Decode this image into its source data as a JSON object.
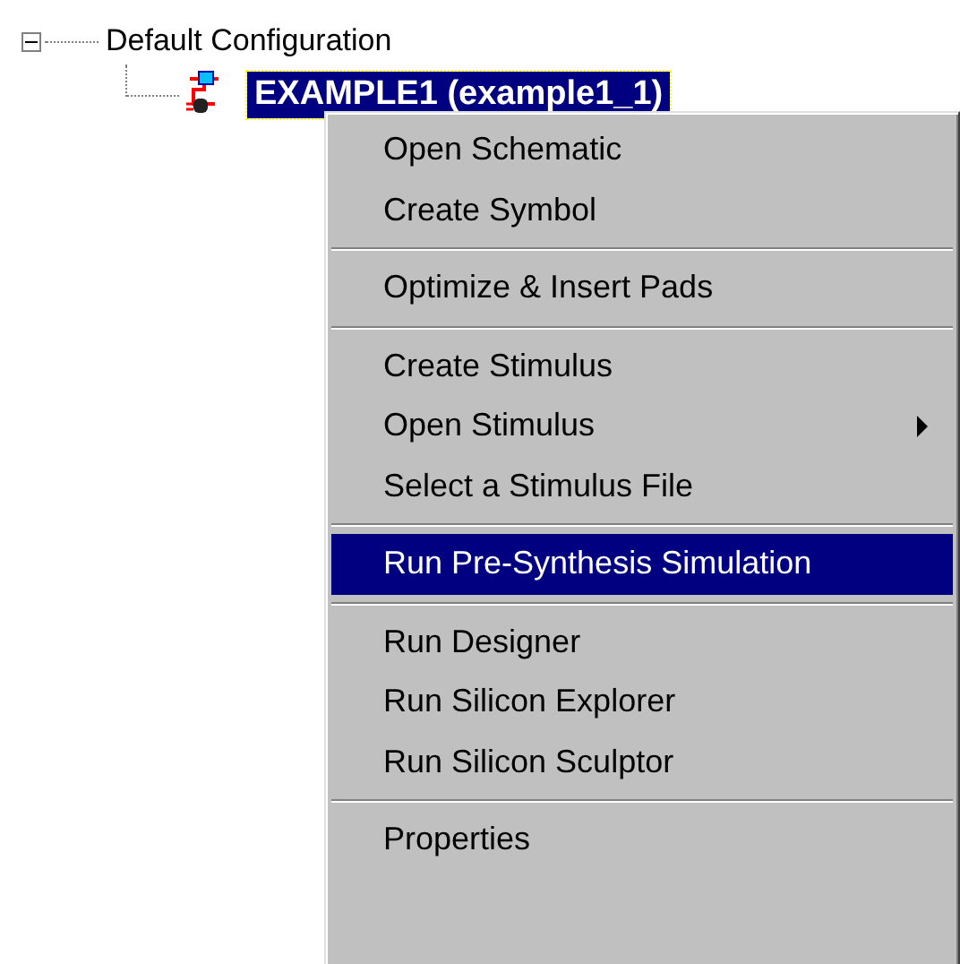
{
  "tree": {
    "label": "Default Configuration",
    "expanded": true,
    "children": [
      {
        "label": "EXAMPLE1 (example1_1)",
        "selected": true
      }
    ]
  },
  "context_menu": {
    "items": [
      {
        "kind": "item",
        "label": "Open Schematic",
        "selected": false,
        "submenu": false
      },
      {
        "kind": "item",
        "label": "Create Symbol",
        "selected": false,
        "submenu": false
      },
      {
        "kind": "separator"
      },
      {
        "kind": "item",
        "label": "Optimize & Insert Pads",
        "selected": false,
        "submenu": false
      },
      {
        "kind": "separator"
      },
      {
        "kind": "item",
        "label": "Create Stimulus",
        "selected": false,
        "submenu": false
      },
      {
        "kind": "item",
        "label": "Open Stimulus",
        "selected": false,
        "submenu": true
      },
      {
        "kind": "item",
        "label": "Select a Stimulus File",
        "selected": false,
        "submenu": false
      },
      {
        "kind": "separator"
      },
      {
        "kind": "item",
        "label": "Run Pre-Synthesis Simulation",
        "selected": true,
        "submenu": false
      },
      {
        "kind": "separator"
      },
      {
        "kind": "item",
        "label": "Run Designer",
        "selected": false,
        "submenu": false
      },
      {
        "kind": "item",
        "label": "Run Silicon Explorer",
        "selected": false,
        "submenu": false
      },
      {
        "kind": "item",
        "label": "Run Silicon Sculptor",
        "selected": false,
        "submenu": false
      },
      {
        "kind": "separator"
      },
      {
        "kind": "item",
        "label": "Properties",
        "selected": false,
        "submenu": false
      }
    ]
  }
}
